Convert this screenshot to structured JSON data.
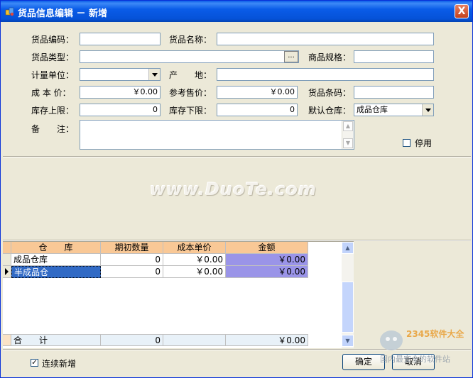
{
  "window": {
    "title": "货品信息编辑 － 新增",
    "close_label": "X"
  },
  "form": {
    "code_label": "货品编码：",
    "code_value": "",
    "name_label": "货品名称：",
    "name_value": "",
    "type_label": "货品类型：",
    "type_value": "",
    "type_button": "...",
    "spec_label": "商品规格：",
    "spec_value": "",
    "unit_label": "计量单位：",
    "unit_value": "",
    "origin_label": "产　　地：",
    "origin_value": "",
    "cost_label": "成 本 价：",
    "cost_value": "￥0.00",
    "ref_price_label": "参考售价：",
    "ref_price_value": "￥0.00",
    "barcode_label": "货品条码：",
    "barcode_value": "",
    "stock_max_label": "库存上限：",
    "stock_max_value": "0",
    "stock_min_label": "库存下限：",
    "stock_min_value": "0",
    "default_wh_label": "默认仓库：",
    "default_wh_value": "成品仓库",
    "remark_label": "备　　注：",
    "remark_value": "",
    "disabled_label": "停用",
    "disabled_checked": false
  },
  "watermark": "www.DuoTe.com",
  "grid": {
    "columns": [
      "仓　　库",
      "期初数量",
      "成本单价",
      "金额"
    ],
    "rows": [
      {
        "warehouse": "成品仓库",
        "qty": "0",
        "unit_cost": "￥0.00",
        "amount": "￥0.00",
        "selected": false
      },
      {
        "warehouse": "半成品仓",
        "qty": "0",
        "unit_cost": "￥0.00",
        "amount": "￥0.00",
        "selected": true
      }
    ],
    "footer": {
      "label": "合　　计",
      "qty": "0",
      "unit_cost": "",
      "amount": "￥0.00"
    }
  },
  "footer": {
    "continue_label": "连续新增",
    "continue_checked": true,
    "ok_label": "确定",
    "cancel_label": "取消"
  },
  "logo": {
    "brand": "2345软件大全",
    "slogan": "国内最安全的软件站"
  },
  "colors": {
    "title_bar": "#0a5ce8",
    "grid_header": "#f9c896",
    "amount_cell": "#9a94e8",
    "selected_row": "#316ac5",
    "window_bg": "#ece9d8"
  }
}
